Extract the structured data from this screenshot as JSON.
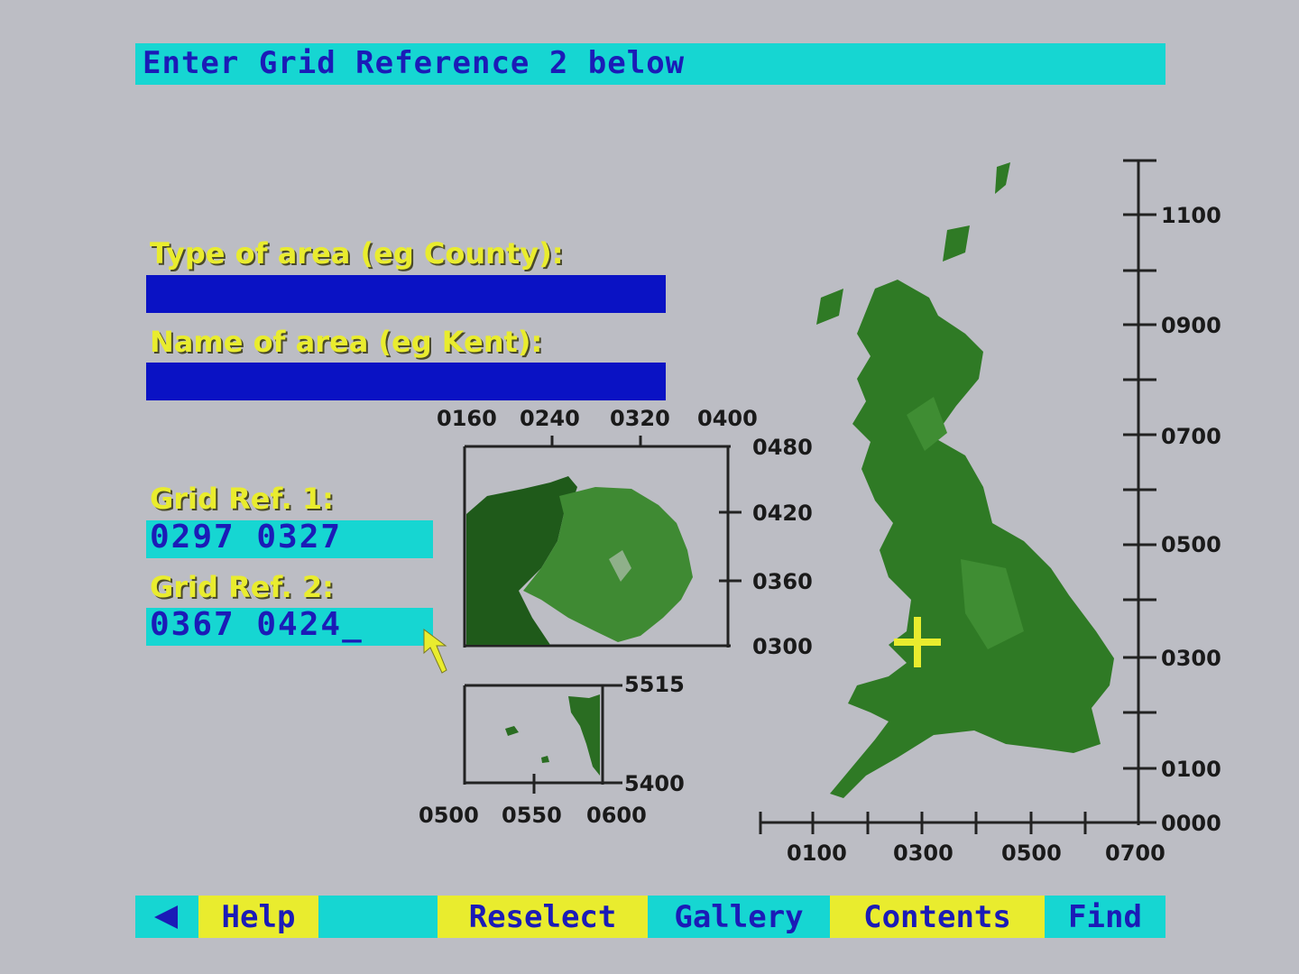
{
  "prompt": {
    "text": "Enter Grid Reference 2 below"
  },
  "form": {
    "type_label": "Type of area (eg County):",
    "type_value": "",
    "name_label": "Name of area (eg Kent):",
    "name_value": "",
    "grid1_label": "Grid Ref. 1:",
    "grid1_value": "0297 0327",
    "grid2_label": "Grid Ref. 2:",
    "grid2_value": "0367 0424_"
  },
  "maps": {
    "ni_top_ticks": [
      "0160",
      "0240",
      "0320",
      "0400"
    ],
    "ni_right_ticks": [
      "0480",
      "0420",
      "0360",
      "0300"
    ],
    "shetland_right_ticks": [
      "5515",
      "5400"
    ],
    "shetland_bottom_ticks": [
      "0500",
      "0550",
      "0600"
    ],
    "gb_right_ticks": [
      "1100",
      "0900",
      "0700",
      "0500",
      "0300",
      "0100",
      "0000"
    ],
    "gb_bottom_ticks": [
      "0100",
      "0300",
      "0500",
      "0700"
    ],
    "land_color": "#2f7a25",
    "marker_color": "#e9ec2e"
  },
  "menu": {
    "back_icon": "left-arrow-icon",
    "help": "Help",
    "reselect": "Reselect",
    "gallery": "Gallery",
    "contents": "Contents",
    "find": "Find"
  }
}
